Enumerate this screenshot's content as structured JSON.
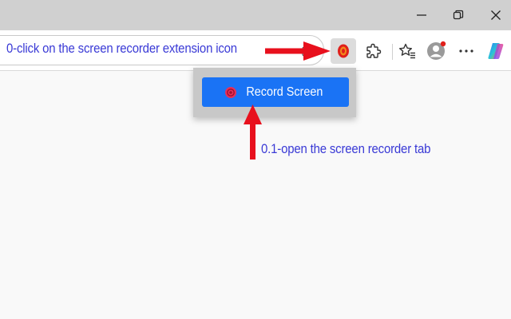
{
  "annotations": {
    "step0": "0-click on the screen recorder extension icon",
    "step0_1": "0.1-open the screen recorder tab"
  },
  "popup": {
    "record_button_label": "Record Screen"
  },
  "toolbar": {
    "icons": [
      "screen-recorder-extension-icon",
      "extensions-puzzle-icon",
      "favorites-star-icon",
      "profile-avatar-icon",
      "more-options-icon",
      "copilot-icon"
    ],
    "notification_color": "#e0201b"
  },
  "colors": {
    "accent_button": "#1a73f5",
    "annotation_text": "#3a3ad6",
    "arrow": "#e8101d"
  }
}
